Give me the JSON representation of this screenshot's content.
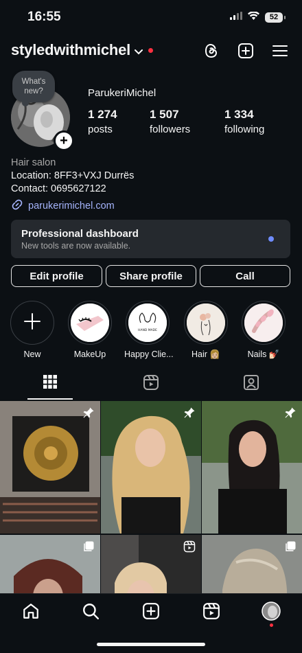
{
  "status": {
    "time": "16:55",
    "battery": "52"
  },
  "header": {
    "username": "styledwithmichel"
  },
  "profile": {
    "note": "What's new?",
    "display_name": "ParukeriMichel",
    "stats": {
      "posts_count": "1 274",
      "posts_label": "posts",
      "followers_count": "1 507",
      "followers_label": "followers",
      "following_count": "1 334",
      "following_label": "following"
    },
    "bio": {
      "category": "Hair salon",
      "location": "Location: 8FF3+VXJ Durrës",
      "contact": "Contact: 0695627122"
    },
    "link": "parukerimichel.com"
  },
  "dashboard": {
    "title": "Professional dashboard",
    "subtitle": "New tools are now available."
  },
  "buttons": {
    "edit": "Edit profile",
    "share": "Share profile",
    "call": "Call"
  },
  "highlights": [
    {
      "label": "New"
    },
    {
      "label": "MakeUp"
    },
    {
      "label": "Happy Clie..."
    },
    {
      "label": "Hair 👩🏼"
    },
    {
      "label": "Nails 💅🏻"
    }
  ],
  "highlight_art": {
    "happy_clients": "HAND MADE"
  },
  "colors": {
    "background": "#0c1014",
    "link": "#a5b4fc",
    "notification": "#ff3040",
    "dashboard_dot": "#6f8cff"
  }
}
